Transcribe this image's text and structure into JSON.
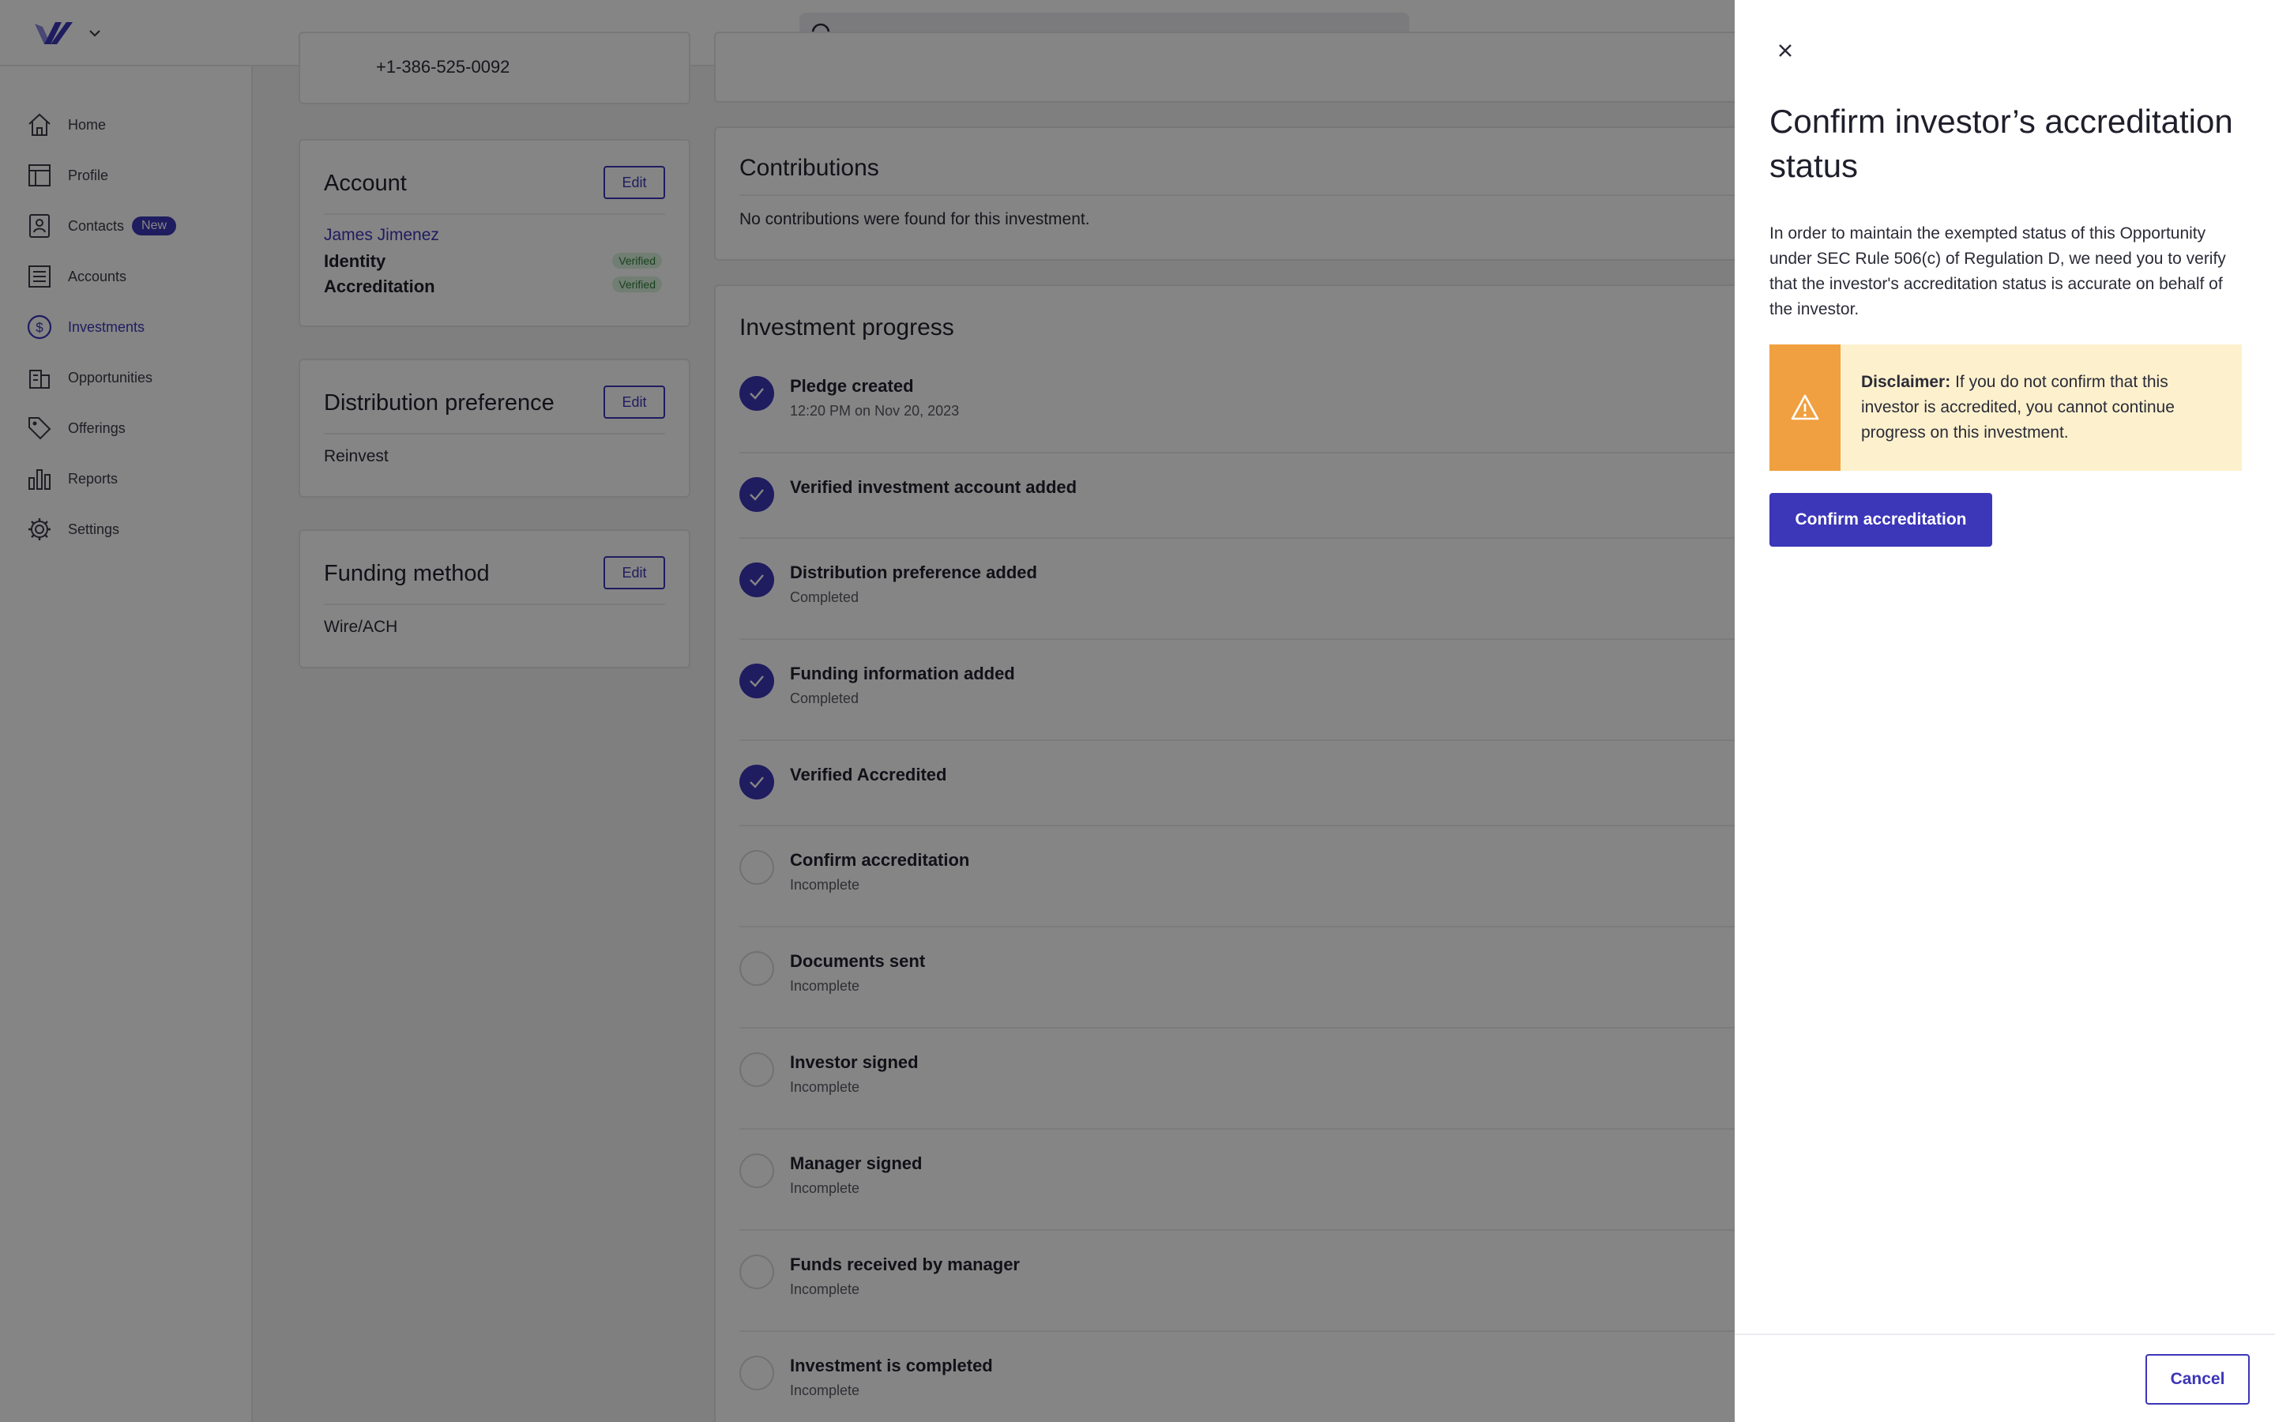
{
  "header": {
    "search_placeholder": ""
  },
  "sidebar": {
    "items": [
      {
        "label": "Home",
        "icon": "home-icon"
      },
      {
        "label": "Profile",
        "icon": "profile-icon"
      },
      {
        "label": "Contacts",
        "icon": "contacts-icon",
        "badge": "New"
      },
      {
        "label": "Accounts",
        "icon": "accounts-icon"
      },
      {
        "label": "Investments",
        "icon": "dollar-icon",
        "active": true
      },
      {
        "label": "Opportunities",
        "icon": "building-icon"
      },
      {
        "label": "Offerings",
        "icon": "tag-icon"
      },
      {
        "label": "Reports",
        "icon": "bar-chart-icon"
      },
      {
        "label": "Settings",
        "icon": "gear-icon"
      }
    ]
  },
  "contact_card": {
    "phone": "+1-386-525-0092"
  },
  "account_card": {
    "title": "Account",
    "edit_label": "Edit",
    "name": "James Jimenez",
    "identity_label": "Identity",
    "identity_status": "Verified",
    "accreditation_label": "Accreditation",
    "accreditation_status": "Verified"
  },
  "distribution_card": {
    "title": "Distribution preference",
    "edit_label": "Edit",
    "value": "Reinvest"
  },
  "funding_card": {
    "title": "Funding method",
    "edit_label": "Edit",
    "value": "Wire/ACH"
  },
  "contributions": {
    "title": "Contributions",
    "empty_text": "No contributions were found for this investment."
  },
  "progress": {
    "title": "Investment progress",
    "steps": [
      {
        "title": "Pledge created",
        "sub": "12:20 PM on Nov 20, 2023",
        "done": true
      },
      {
        "title": "Verified investment account added",
        "sub": "",
        "done": true
      },
      {
        "title": "Distribution preference added",
        "sub": "Completed",
        "done": true
      },
      {
        "title": "Funding information added",
        "sub": "Completed",
        "done": true
      },
      {
        "title": "Verified Accredited",
        "sub": "",
        "done": true
      },
      {
        "title": "Confirm accreditation",
        "sub": "Incomplete",
        "done": false
      },
      {
        "title": "Documents sent",
        "sub": "Incomplete",
        "done": false
      },
      {
        "title": "Investor signed",
        "sub": "Incomplete",
        "done": false
      },
      {
        "title": "Manager signed",
        "sub": "Incomplete",
        "done": false
      },
      {
        "title": "Funds received by manager",
        "sub": "Incomplete",
        "done": false
      },
      {
        "title": "Investment is completed",
        "sub": "Incomplete",
        "done": false
      }
    ]
  },
  "drawer": {
    "title": "Confirm investor’s accreditation status",
    "body": "In order to maintain the exempted status of this Opportunity under SEC Rule 506(c) of Regulation D, we need you to verify that the investor's accreditation status is accurate on behalf of the investor.",
    "disclaimer_label": "Disclaimer:",
    "disclaimer_text": " If you do not confirm that this investor is accredited, you cannot continue progress on this investment.",
    "confirm_label": "Confirm accreditation",
    "cancel_label": "Cancel"
  },
  "colors": {
    "accent": "#3c36b8",
    "warning": "#f0a040",
    "warning_bg": "#fdf1cd",
    "verified_bg": "#d9f2dc"
  }
}
